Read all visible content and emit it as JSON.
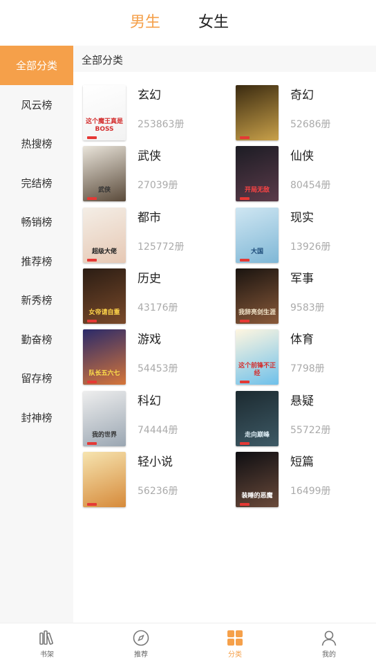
{
  "top_tabs": {
    "male": "男生",
    "female": "女生"
  },
  "sidebar": {
    "items": [
      {
        "label": "全部分类"
      },
      {
        "label": "风云榜"
      },
      {
        "label": "热搜榜"
      },
      {
        "label": "完结榜"
      },
      {
        "label": "畅销榜"
      },
      {
        "label": "推荐榜"
      },
      {
        "label": "新秀榜"
      },
      {
        "label": "勤奋榜"
      },
      {
        "label": "留存榜"
      },
      {
        "label": "封神榜"
      }
    ],
    "active_index": 0
  },
  "main": {
    "section_title": "全部分类",
    "categories": [
      {
        "name": "玄幻",
        "count": "253863册",
        "cover_text": "这个魔王真是BOSS",
        "cover_colors": [
          "#ffffff",
          "#f2f2f2"
        ],
        "cover_text_color": "#d32f2f"
      },
      {
        "name": "奇幻",
        "count": "52686册",
        "cover_text": "",
        "cover_colors": [
          "#3a2a10",
          "#c9a14a"
        ],
        "cover_text_color": "#ffd27a"
      },
      {
        "name": "武侠",
        "count": "27039册",
        "cover_text": "武侠",
        "cover_colors": [
          "#e9e4da",
          "#5a4a3a"
        ],
        "cover_text_color": "#333333"
      },
      {
        "name": "仙侠",
        "count": "80454册",
        "cover_text": "开局无敌",
        "cover_colors": [
          "#1c1c24",
          "#5b3b4a"
        ],
        "cover_text_color": "#ff4444"
      },
      {
        "name": "都市",
        "count": "125772册",
        "cover_text": "超级大佬",
        "cover_colors": [
          "#f4eee6",
          "#e6c8b4"
        ],
        "cover_text_color": "#222222"
      },
      {
        "name": "现实",
        "count": "13926册",
        "cover_text": "大国",
        "cover_colors": [
          "#cfe6f2",
          "#7fb7d6"
        ],
        "cover_text_color": "#1e4c7a"
      },
      {
        "name": "历史",
        "count": "43176册",
        "cover_text": "女帝请自重",
        "cover_colors": [
          "#2b1d14",
          "#7a4a2a"
        ],
        "cover_text_color": "#ffd54a"
      },
      {
        "name": "军事",
        "count": "9583册",
        "cover_text": "我辞亮剑生涯",
        "cover_colors": [
          "#1a1410",
          "#8a5a3a"
        ],
        "cover_text_color": "#f1e3c8"
      },
      {
        "name": "游戏",
        "count": "54453册",
        "cover_text": "队长五六七",
        "cover_colors": [
          "#2a2a6a",
          "#d6763a"
        ],
        "cover_text_color": "#ffe14a"
      },
      {
        "name": "体育",
        "count": "7798册",
        "cover_text": "这个前锋不正经",
        "cover_colors": [
          "#fff6e0",
          "#6ec0ea"
        ],
        "cover_text_color": "#d32f2f"
      },
      {
        "name": "科幻",
        "count": "74444册",
        "cover_text": "我的世界",
        "cover_colors": [
          "#eeeeee",
          "#9aa6b2"
        ],
        "cover_text_color": "#333333"
      },
      {
        "name": "悬疑",
        "count": "55722册",
        "cover_text": "走向巅峰",
        "cover_colors": [
          "#1c2a30",
          "#3e5a66"
        ],
        "cover_text_color": "#d6e6ee"
      },
      {
        "name": "轻小说",
        "count": "56236册",
        "cover_text": "",
        "cover_colors": [
          "#f6e4b0",
          "#d68a3a"
        ],
        "cover_text_color": "#333333"
      },
      {
        "name": "短篇",
        "count": "16499册",
        "cover_text": "装睡的恶魔",
        "cover_colors": [
          "#0e0e12",
          "#6a4a3a"
        ],
        "cover_text_color": "#ffffff"
      }
    ]
  },
  "bottom_nav": {
    "items": [
      {
        "label": "书架",
        "icon": "bookshelf-icon"
      },
      {
        "label": "推荐",
        "icon": "compass-icon"
      },
      {
        "label": "分类",
        "icon": "category-grid-icon"
      },
      {
        "label": "我的",
        "icon": "user-icon"
      }
    ],
    "active_index": 2
  },
  "colors": {
    "accent": "#f5a04a",
    "sidebar_bg": "#f7f7f7",
    "muted_text": "#aaaaaa"
  }
}
